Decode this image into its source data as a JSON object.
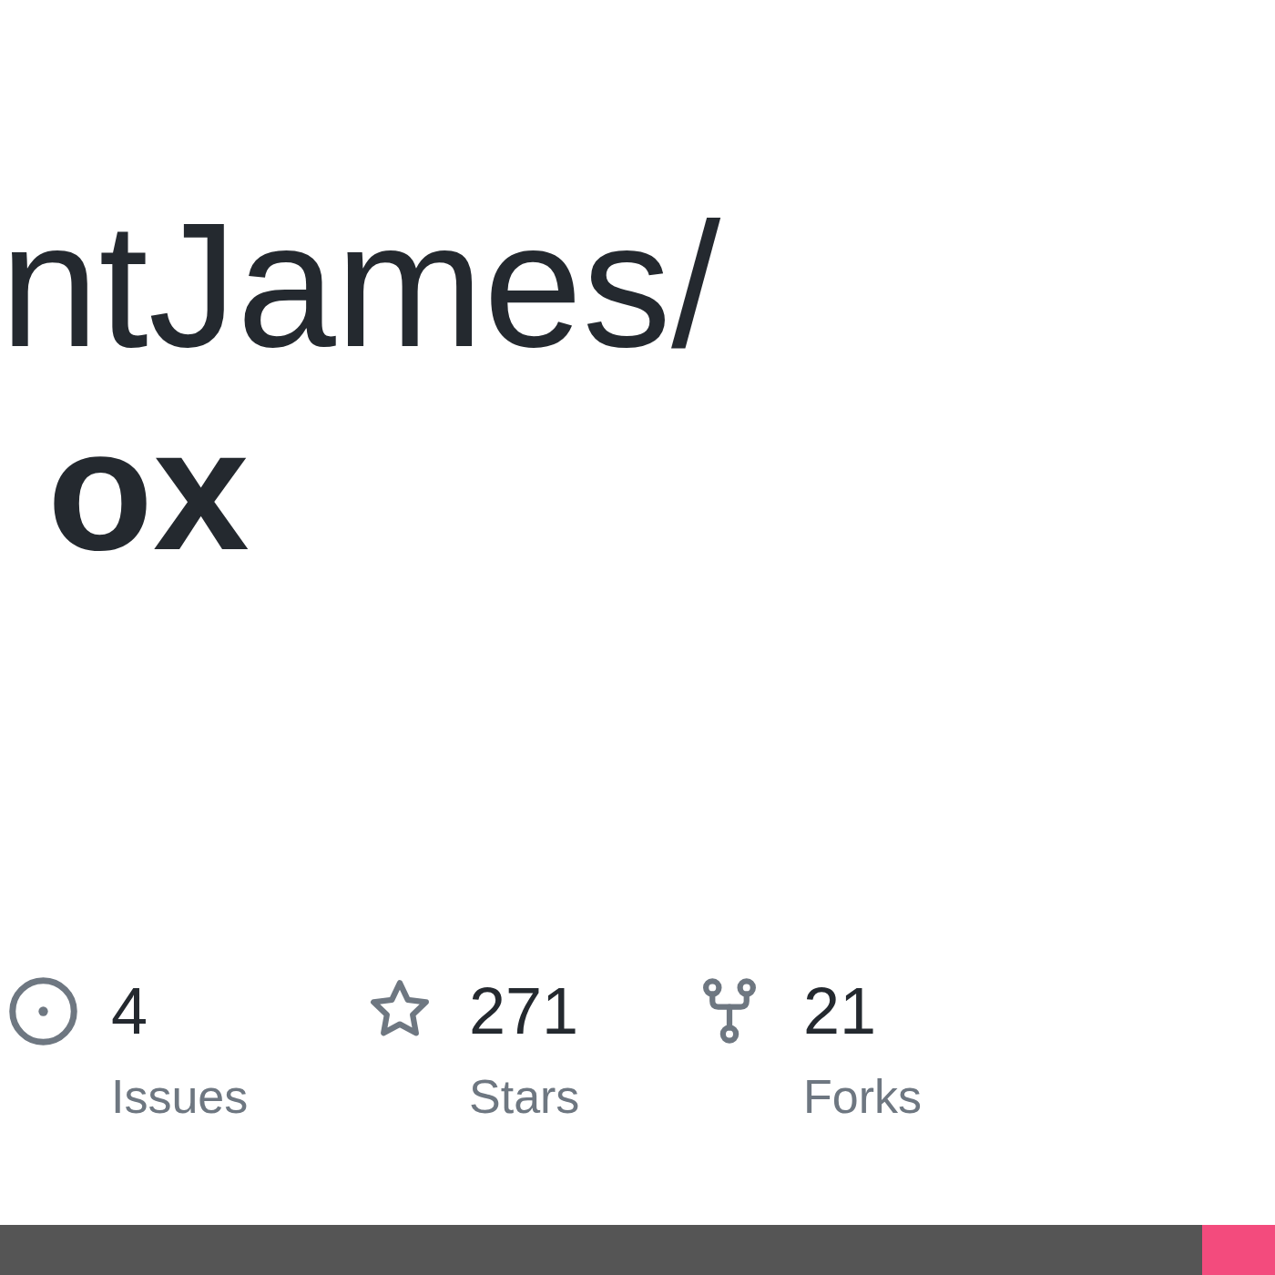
{
  "repository": {
    "owner": "ntJames/",
    "name": "ox"
  },
  "stats": [
    {
      "kind": "issues",
      "count": "4",
      "label": "Issues"
    },
    {
      "kind": "stars",
      "count": "271",
      "label": "Stars"
    },
    {
      "kind": "forks",
      "count": "21",
      "label": "Forks"
    }
  ],
  "language_bar": [
    {
      "color": "#555555",
      "level": 0.943
    },
    {
      "color": "#f34b7d",
      "level": 0.057
    }
  ]
}
